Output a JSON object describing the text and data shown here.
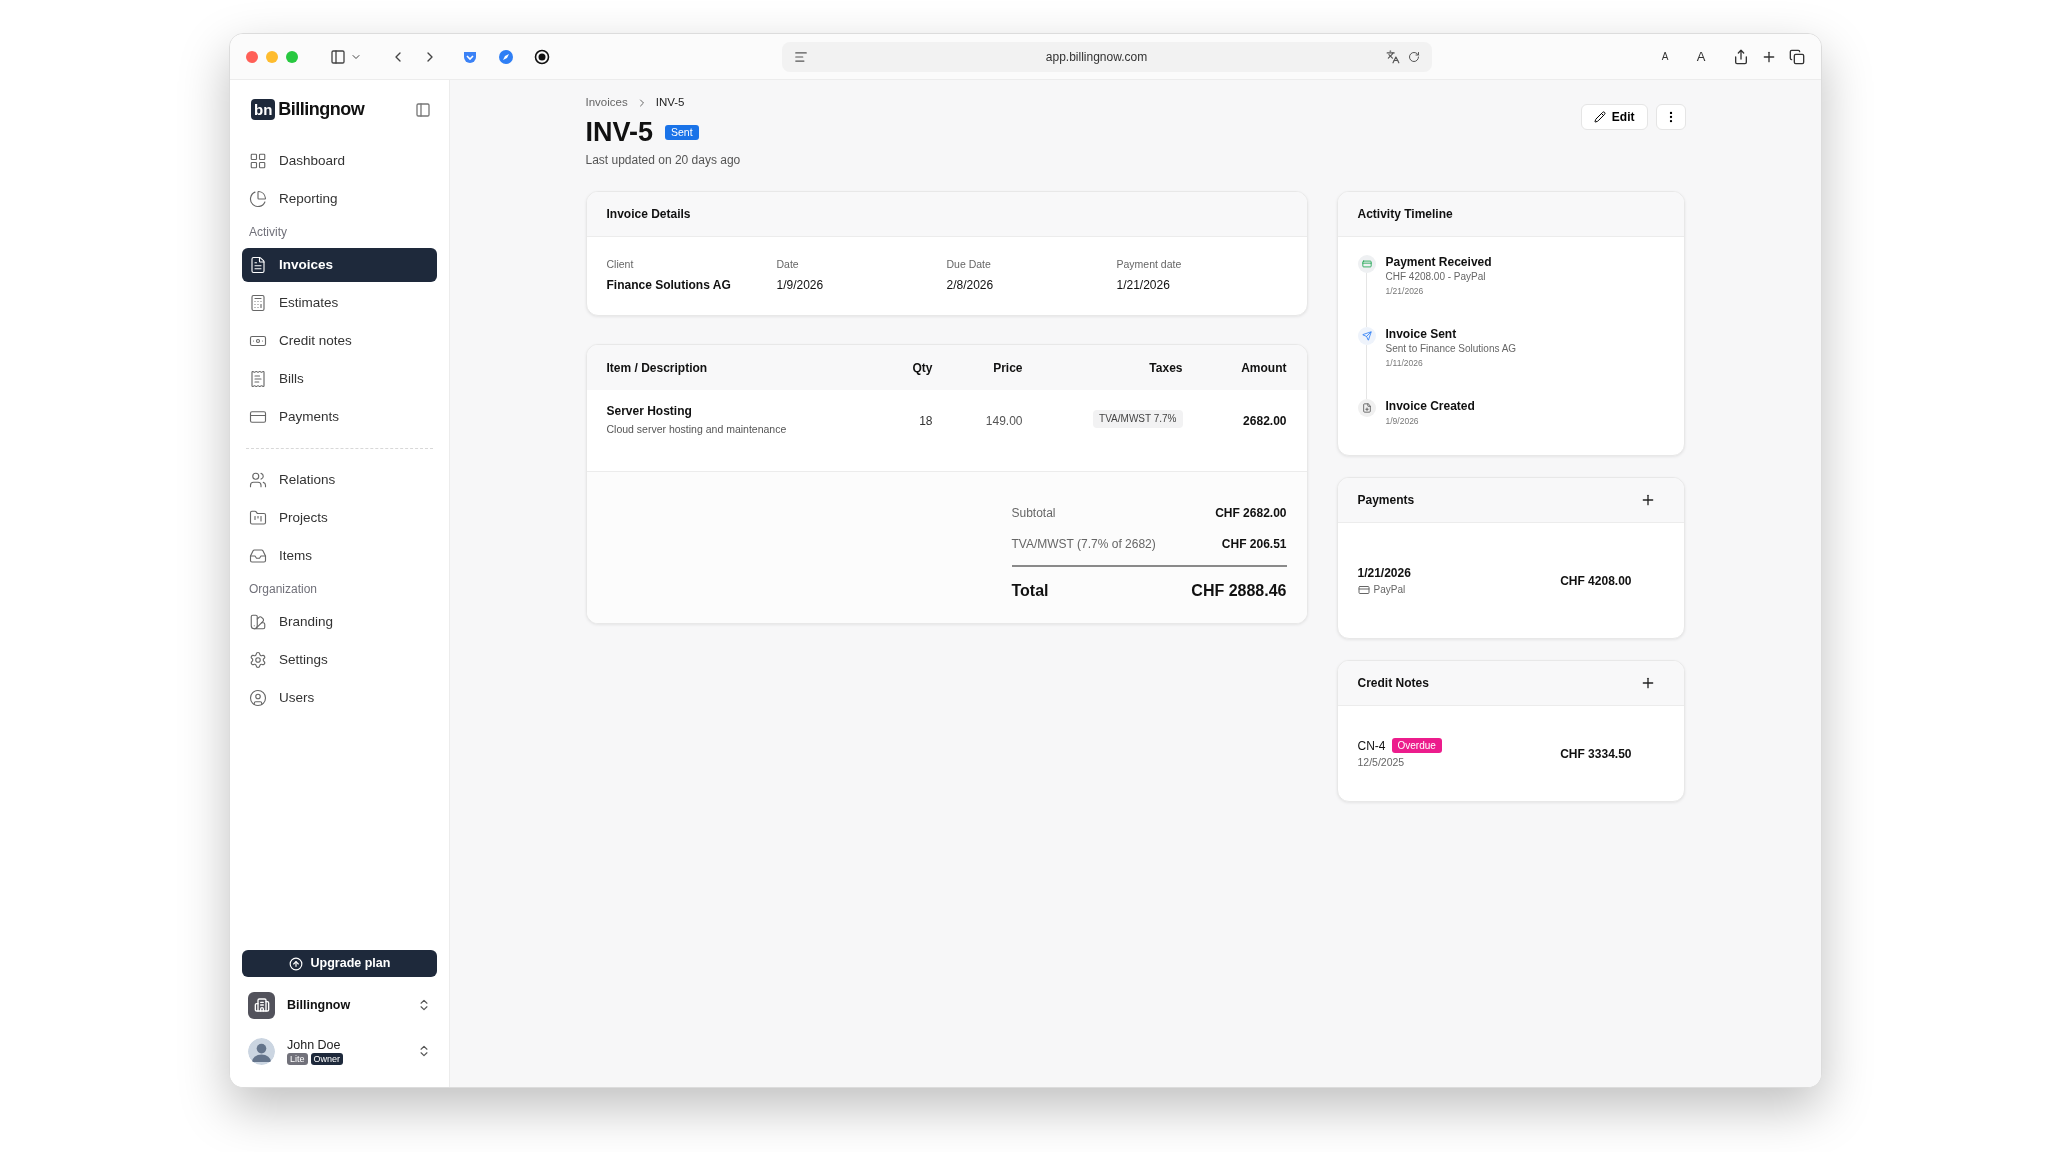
{
  "browser": {
    "url": "app.billingnow.com",
    "text_size_buttons": [
      "A",
      "A"
    ]
  },
  "sidebar": {
    "brand": {
      "mark": "bn",
      "name": "Billingnow"
    },
    "sections": [
      {
        "items": [
          {
            "label": "Dashboard",
            "selected": false
          },
          {
            "label": "Reporting",
            "selected": false
          }
        ]
      },
      {
        "heading": "Activity",
        "items": [
          {
            "label": "Invoices",
            "selected": true
          },
          {
            "label": "Estimates",
            "selected": false
          },
          {
            "label": "Credit notes",
            "selected": false
          },
          {
            "label": "Bills",
            "selected": false
          },
          {
            "label": "Payments",
            "selected": false
          }
        ]
      },
      {
        "divider_before": true,
        "items": [
          {
            "label": "Relations",
            "selected": false
          },
          {
            "label": "Projects",
            "selected": false
          },
          {
            "label": "Items",
            "selected": false
          }
        ]
      },
      {
        "heading": "Organization",
        "items": [
          {
            "label": "Branding",
            "selected": false
          },
          {
            "label": "Settings",
            "selected": false
          },
          {
            "label": "Users",
            "selected": false
          }
        ]
      }
    ],
    "upgrade_button": "Upgrade plan",
    "workspace": {
      "name": "Billingnow"
    },
    "user": {
      "name": "John Doe",
      "badges": [
        {
          "label": "Lite",
          "color": "#71717a"
        },
        {
          "label": "Owner",
          "color": "#1e293b"
        }
      ]
    }
  },
  "main": {
    "breadcrumb": [
      "Invoices",
      "INV-5"
    ],
    "title": "INV-5",
    "status": {
      "label": "Sent",
      "color": "#1a73e8"
    },
    "subtitle": "Last updated on 20 days ago",
    "edit_button": "Edit",
    "invoice_details": {
      "title": "Invoice Details",
      "fields": [
        {
          "label": "Client",
          "value": "Finance Solutions AG",
          "strong": true
        },
        {
          "label": "Date",
          "value": "1/9/2026",
          "strong": false
        },
        {
          "label": "Due Date",
          "value": "2/8/2026",
          "strong": false
        },
        {
          "label": "Payment date",
          "value": "1/21/2026",
          "strong": false
        }
      ]
    },
    "items_table": {
      "columns": [
        "Item / Description",
        "Qty",
        "Price",
        "Taxes",
        "Amount"
      ],
      "rows": [
        {
          "item": "Server Hosting",
          "description": "Cloud server hosting and maintenance",
          "qty": "18",
          "price": "149.00",
          "tax": "TVA/MWST 7.7%",
          "amount": "2682.00"
        }
      ],
      "totals": [
        {
          "label": "Subtotal",
          "value": "CHF 2682.00"
        },
        {
          "label": "TVA/MWST (7.7% of 2682)",
          "value": "CHF 206.51"
        }
      ],
      "total": {
        "label": "Total",
        "value": "CHF 2888.46"
      }
    },
    "timeline": {
      "title": "Activity Timeline",
      "events": [
        {
          "kind": "payment",
          "title": "Payment Received",
          "lines": [
            "CHF 4208.00 - PayPal"
          ],
          "date": "1/21/2026"
        },
        {
          "kind": "sent",
          "title": "Invoice Sent",
          "lines": [
            "Sent to Finance Solutions AG"
          ],
          "date": "1/11/2026"
        },
        {
          "kind": "created",
          "title": "Invoice Created",
          "date": "1/9/2026"
        }
      ]
    },
    "payments": {
      "title": "Payments",
      "rows": [
        {
          "date": "1/21/2026",
          "method": "PayPal",
          "amount": "CHF 4208.00"
        }
      ]
    },
    "credit_notes": {
      "title": "Credit Notes",
      "rows": [
        {
          "number": "CN-4",
          "status": {
            "label": "Overdue",
            "color": "#ec1c8c"
          },
          "date": "12/5/2025",
          "amount": "CHF 3334.50"
        }
      ]
    }
  }
}
